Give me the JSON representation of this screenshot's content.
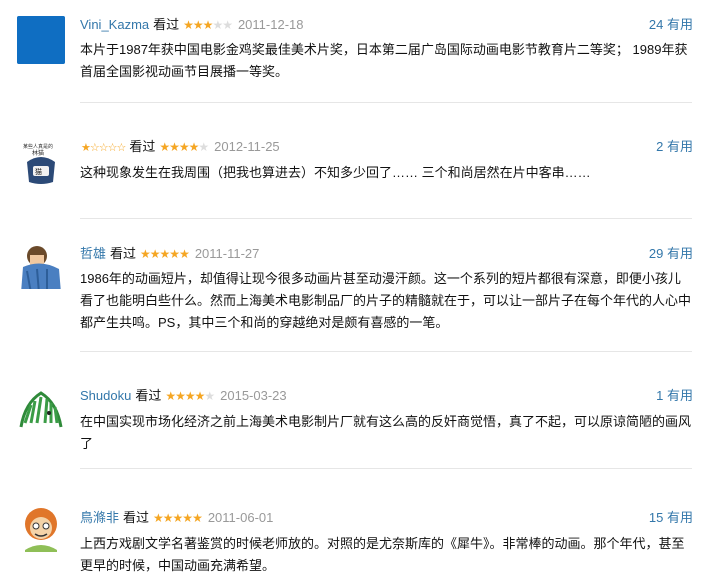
{
  "reviews": [
    {
      "user": "Vini_Kazma",
      "user_stars": "",
      "action": "看过",
      "rating": 3,
      "date": "2011-12-18",
      "useful": "24 有用",
      "text": "本片于1987年获中国电影金鸡奖最佳美术片奖，日本第二届广岛国际动画电影节教育片二等奖； 1989年获首届全国影视动画节目展播一等奖。",
      "avatar_color": "#0a6bbd"
    },
    {
      "user": "",
      "user_stars": "★☆☆☆☆",
      "action": "看过",
      "rating": 4,
      "date": "2012-11-25",
      "useful": "2 有用",
      "text": "这种现象发生在我周围（把我也算进去）不知多少回了…… 三个和尚居然在片中客串……"
    },
    {
      "user": "哲雄",
      "user_stars": "",
      "action": "看过",
      "rating": 5,
      "date": "2011-11-27",
      "useful": "29 有用",
      "text": "1986年的动画短片，却值得让现今很多动画片甚至动漫汗颜。这一个系列的短片都很有深意，即便小孩儿看了也能明白些什么。然而上海美术电影制品厂的片子的精髓就在于，可以让一部片子在每个年代的人心中都产生共鸣。PS，其中三个和尚的穿越绝对是颇有喜感的一笔。"
    },
    {
      "user": "Shudoku",
      "user_stars": "",
      "action": "看过",
      "rating": 4,
      "date": "2015-03-23",
      "useful": "1 有用",
      "text": "在中国实现市场化经济之前上海美术电影制片厂就有这么高的反奸商觉悟，真了不起，可以原谅简陋的画风了"
    },
    {
      "user": "鳥滌非",
      "user_stars": "",
      "action": "看过",
      "rating": 5,
      "date": "2011-06-01",
      "useful": "15 有用",
      "text": "上西方戏剧文学名著鉴赏的时候老师放的。对照的是尤奈斯库的《犀牛》。非常棒的动画。那个年代，甚至更早的时候，中国动画充满希望。"
    }
  ],
  "colors": {
    "link": "#3377aa",
    "star": "#f5a623",
    "date": "#999999"
  }
}
